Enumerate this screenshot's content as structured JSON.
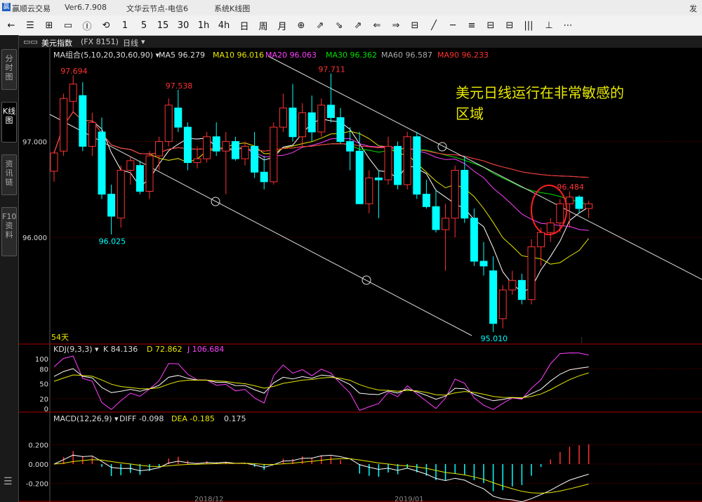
{
  "window": {
    "app_title": "赢顺云交易",
    "version": "Ver6.7.908",
    "node": "文华云节点-电信6",
    "menu_system": "系统K线图"
  },
  "toolbar": {
    "buttons": [
      "←",
      "☰",
      "⊞",
      "▭",
      "Ⓘ",
      "⟲",
      "1",
      "5",
      "15",
      "30",
      "1h",
      "4h",
      "日",
      "周",
      "月",
      "⊕",
      "⇗",
      "⇘",
      "⇗",
      "⇐",
      "⇒",
      "⊟",
      "╱",
      "─",
      "≡",
      "⊟",
      "⊟",
      "|||",
      "⊥",
      "⋯"
    ],
    "periods": [
      "1",
      "5",
      "15",
      "30",
      "1h",
      "4h",
      "日",
      "周",
      "月"
    ]
  },
  "sidebar": {
    "tabs": [
      {
        "label": "分时图"
      },
      {
        "label": "K线图"
      },
      {
        "label": "资讯链"
      },
      {
        "label": "F10资料"
      }
    ]
  },
  "instrument": {
    "name": "美元指数",
    "code": "(FX 8151)",
    "period": "日线"
  },
  "ma_legend": {
    "label": "MA组合(5,10,20,30,60,90)",
    "items": [
      {
        "text": "MA5 96.279",
        "color": "#ffffff"
      },
      {
        "text": "MA10 96.016",
        "color": "#e8e800"
      },
      {
        "text": "MA20 96.063",
        "color": "#ff40ff"
      },
      {
        "text": "MA30 96.362",
        "color": "#00e000"
      },
      {
        "text": "MA60 96.587",
        "color": "#aaaaaa"
      },
      {
        "text": "MA90 96.233",
        "color": "#ff3030"
      }
    ]
  },
  "price_axis": {
    "ticks": [
      {
        "label": "97.000",
        "value": 97.0
      },
      {
        "label": "96.000",
        "value": 96.0
      }
    ]
  },
  "annotations": {
    "highs": [
      {
        "text": "97.694",
        "value": 97.694
      },
      {
        "text": "97.538",
        "value": 97.538
      },
      {
        "text": "97.711",
        "value": 97.711
      },
      {
        "text": "96.484",
        "value": 96.484
      }
    ],
    "lows": [
      {
        "text": "96.025",
        "value": 96.025
      },
      {
        "text": "95.010",
        "value": 95.01
      }
    ],
    "comment": "美元日线运行在非常敏感的区域",
    "days": "54天",
    "dates": [
      "2018/12",
      "2019/01"
    ]
  },
  "kdj": {
    "label": "KDJ(9,3,3)",
    "k": "K 84.136",
    "d": "D 72.862",
    "j": "J 106.684",
    "ticks": [
      "100",
      "80",
      "50",
      "20",
      "0"
    ]
  },
  "macd": {
    "label": "MACD(12,26,9)",
    "diff": "DIFF -0.098",
    "dea": "DEA -0.185",
    "macd": "0.175",
    "ticks": [
      "0.200",
      "0.000",
      "-0.200"
    ]
  },
  "chart_data": {
    "type": "candlestick",
    "ohlc": [
      [
        96.69,
        96.9,
        96.58,
        96.88
      ],
      [
        96.9,
        97.5,
        96.85,
        97.45
      ],
      [
        97.42,
        97.69,
        97.3,
        97.6
      ],
      [
        97.48,
        97.62,
        96.9,
        96.95
      ],
      [
        96.95,
        97.3,
        96.85,
        97.2
      ],
      [
        97.1,
        97.25,
        96.4,
        96.45
      ],
      [
        96.45,
        96.55,
        96.03,
        96.22
      ],
      [
        96.2,
        96.75,
        96.1,
        96.7
      ],
      [
        96.7,
        96.85,
        96.55,
        96.8
      ],
      [
        96.75,
        96.8,
        96.45,
        96.48
      ],
      [
        96.48,
        96.9,
        96.4,
        96.85
      ],
      [
        96.85,
        97.05,
        96.7,
        97.0
      ],
      [
        97.0,
        97.45,
        96.95,
        97.38
      ],
      [
        97.35,
        97.54,
        97.1,
        97.15
      ],
      [
        97.15,
        97.2,
        96.7,
        96.78
      ],
      [
        96.78,
        96.95,
        96.72,
        96.82
      ],
      [
        96.82,
        97.1,
        96.78,
        97.05
      ],
      [
        97.05,
        97.2,
        96.85,
        96.9
      ],
      [
        96.9,
        97.1,
        96.45,
        97.0
      ],
      [
        97.0,
        97.05,
        96.8,
        96.82
      ],
      [
        96.82,
        97.0,
        96.75,
        96.95
      ],
      [
        96.95,
        97.1,
        96.62,
        96.68
      ],
      [
        96.68,
        96.85,
        96.5,
        96.58
      ],
      [
        96.58,
        97.2,
        96.55,
        97.15
      ],
      [
        97.15,
        97.5,
        97.1,
        97.35
      ],
      [
        97.35,
        97.6,
        97.0,
        97.05
      ],
      [
        97.05,
        97.4,
        96.95,
        97.3
      ],
      [
        97.3,
        97.48,
        97.0,
        97.1
      ],
      [
        97.1,
        97.45,
        97.05,
        97.38
      ],
      [
        97.38,
        97.71,
        97.2,
        97.25
      ],
      [
        97.25,
        97.35,
        96.98,
        97.0
      ],
      [
        97.0,
        97.15,
        96.7,
        96.9
      ],
      [
        96.9,
        97.1,
        96.4,
        96.35
      ],
      [
        96.35,
        96.7,
        96.25,
        96.62
      ],
      [
        96.62,
        96.7,
        96.2,
        96.6
      ],
      [
        96.6,
        97.05,
        96.55,
        96.95
      ],
      [
        96.95,
        97.0,
        96.5,
        96.55
      ],
      [
        96.55,
        97.1,
        96.5,
        97.05
      ],
      [
        97.05,
        97.1,
        96.4,
        96.45
      ],
      [
        96.45,
        96.6,
        96.3,
        96.32
      ],
      [
        96.32,
        96.5,
        96.05,
        96.08
      ],
      [
        96.08,
        96.35,
        95.65,
        96.2
      ],
      [
        96.2,
        96.75,
        96.0,
        96.7
      ],
      [
        96.7,
        96.85,
        96.15,
        96.2
      ],
      [
        96.2,
        96.3,
        95.7,
        95.75
      ],
      [
        95.75,
        95.95,
        95.6,
        95.7
      ],
      [
        95.65,
        95.8,
        95.01,
        95.1
      ],
      [
        95.15,
        95.5,
        95.05,
        95.45
      ],
      [
        95.45,
        95.65,
        95.4,
        95.55
      ],
      [
        95.55,
        95.62,
        95.3,
        95.35
      ],
      [
        95.35,
        95.98,
        95.3,
        95.9
      ],
      [
        95.9,
        96.1,
        95.7,
        96.05
      ],
      [
        96.05,
        96.2,
        95.95,
        96.15
      ],
      [
        96.15,
        96.4,
        96.05,
        96.35
      ],
      [
        96.35,
        96.48,
        96.1,
        96.42
      ],
      [
        96.42,
        96.44,
        96.25,
        96.3
      ],
      [
        96.3,
        96.38,
        96.2,
        96.35
      ]
    ],
    "ylim": [
      94.9,
      97.95
    ]
  }
}
